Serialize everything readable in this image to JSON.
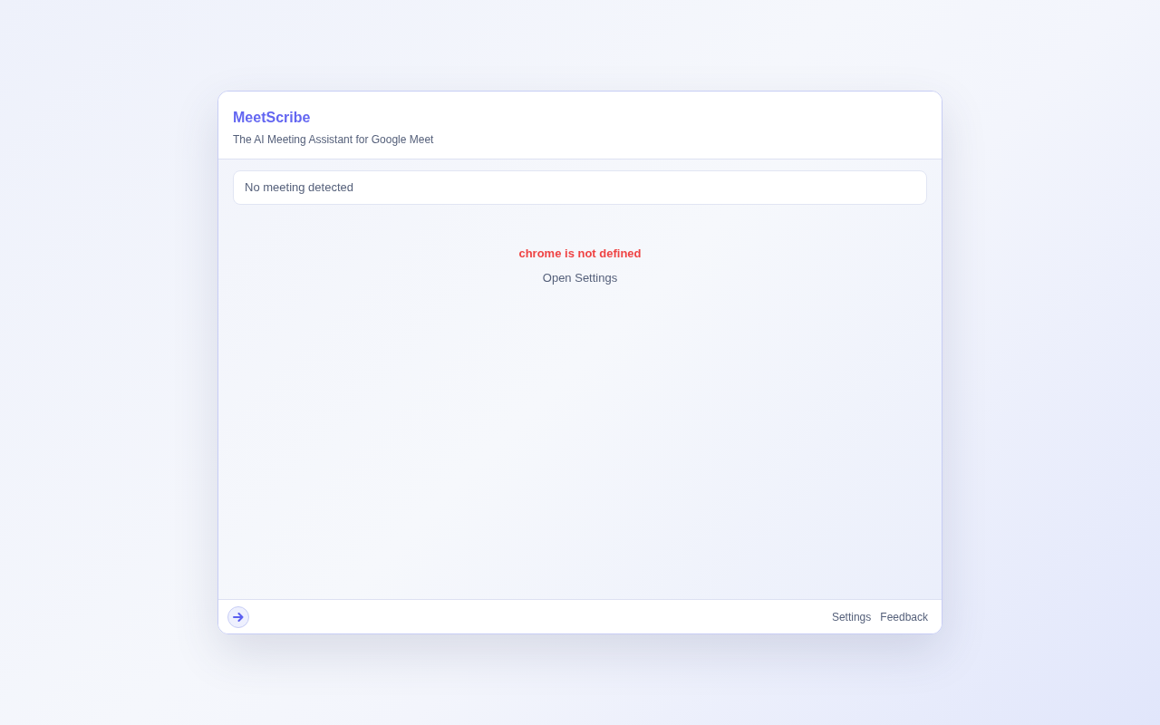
{
  "header": {
    "title": "MeetScribe",
    "subtitle": "The AI Meeting Assistant for Google Meet"
  },
  "status": {
    "text": "No meeting detected"
  },
  "error": {
    "message": "chrome is not defined",
    "action": "Open Settings"
  },
  "footer": {
    "links": [
      "Settings",
      "Feedback"
    ]
  }
}
